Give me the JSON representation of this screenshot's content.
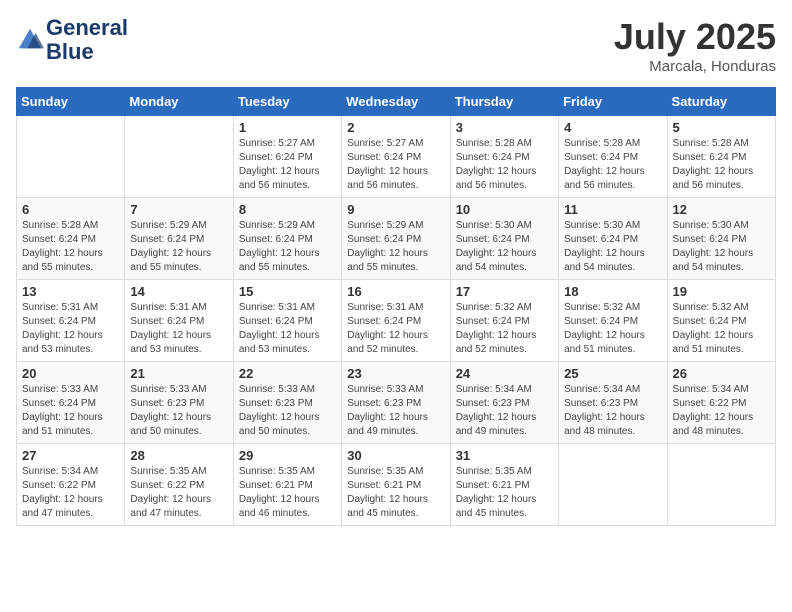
{
  "header": {
    "logo_line1": "General",
    "logo_line2": "Blue",
    "month": "July 2025",
    "location": "Marcala, Honduras"
  },
  "weekdays": [
    "Sunday",
    "Monday",
    "Tuesday",
    "Wednesday",
    "Thursday",
    "Friday",
    "Saturday"
  ],
  "weeks": [
    [
      {
        "day": "",
        "info": ""
      },
      {
        "day": "",
        "info": ""
      },
      {
        "day": "1",
        "info": "Sunrise: 5:27 AM\nSunset: 6:24 PM\nDaylight: 12 hours and 56 minutes."
      },
      {
        "day": "2",
        "info": "Sunrise: 5:27 AM\nSunset: 6:24 PM\nDaylight: 12 hours and 56 minutes."
      },
      {
        "day": "3",
        "info": "Sunrise: 5:28 AM\nSunset: 6:24 PM\nDaylight: 12 hours and 56 minutes."
      },
      {
        "day": "4",
        "info": "Sunrise: 5:28 AM\nSunset: 6:24 PM\nDaylight: 12 hours and 56 minutes."
      },
      {
        "day": "5",
        "info": "Sunrise: 5:28 AM\nSunset: 6:24 PM\nDaylight: 12 hours and 56 minutes."
      }
    ],
    [
      {
        "day": "6",
        "info": "Sunrise: 5:28 AM\nSunset: 6:24 PM\nDaylight: 12 hours and 55 minutes."
      },
      {
        "day": "7",
        "info": "Sunrise: 5:29 AM\nSunset: 6:24 PM\nDaylight: 12 hours and 55 minutes."
      },
      {
        "day": "8",
        "info": "Sunrise: 5:29 AM\nSunset: 6:24 PM\nDaylight: 12 hours and 55 minutes."
      },
      {
        "day": "9",
        "info": "Sunrise: 5:29 AM\nSunset: 6:24 PM\nDaylight: 12 hours and 55 minutes."
      },
      {
        "day": "10",
        "info": "Sunrise: 5:30 AM\nSunset: 6:24 PM\nDaylight: 12 hours and 54 minutes."
      },
      {
        "day": "11",
        "info": "Sunrise: 5:30 AM\nSunset: 6:24 PM\nDaylight: 12 hours and 54 minutes."
      },
      {
        "day": "12",
        "info": "Sunrise: 5:30 AM\nSunset: 6:24 PM\nDaylight: 12 hours and 54 minutes."
      }
    ],
    [
      {
        "day": "13",
        "info": "Sunrise: 5:31 AM\nSunset: 6:24 PM\nDaylight: 12 hours and 53 minutes."
      },
      {
        "day": "14",
        "info": "Sunrise: 5:31 AM\nSunset: 6:24 PM\nDaylight: 12 hours and 53 minutes."
      },
      {
        "day": "15",
        "info": "Sunrise: 5:31 AM\nSunset: 6:24 PM\nDaylight: 12 hours and 53 minutes."
      },
      {
        "day": "16",
        "info": "Sunrise: 5:31 AM\nSunset: 6:24 PM\nDaylight: 12 hours and 52 minutes."
      },
      {
        "day": "17",
        "info": "Sunrise: 5:32 AM\nSunset: 6:24 PM\nDaylight: 12 hours and 52 minutes."
      },
      {
        "day": "18",
        "info": "Sunrise: 5:32 AM\nSunset: 6:24 PM\nDaylight: 12 hours and 51 minutes."
      },
      {
        "day": "19",
        "info": "Sunrise: 5:32 AM\nSunset: 6:24 PM\nDaylight: 12 hours and 51 minutes."
      }
    ],
    [
      {
        "day": "20",
        "info": "Sunrise: 5:33 AM\nSunset: 6:24 PM\nDaylight: 12 hours and 51 minutes."
      },
      {
        "day": "21",
        "info": "Sunrise: 5:33 AM\nSunset: 6:23 PM\nDaylight: 12 hours and 50 minutes."
      },
      {
        "day": "22",
        "info": "Sunrise: 5:33 AM\nSunset: 6:23 PM\nDaylight: 12 hours and 50 minutes."
      },
      {
        "day": "23",
        "info": "Sunrise: 5:33 AM\nSunset: 6:23 PM\nDaylight: 12 hours and 49 minutes."
      },
      {
        "day": "24",
        "info": "Sunrise: 5:34 AM\nSunset: 6:23 PM\nDaylight: 12 hours and 49 minutes."
      },
      {
        "day": "25",
        "info": "Sunrise: 5:34 AM\nSunset: 6:23 PM\nDaylight: 12 hours and 48 minutes."
      },
      {
        "day": "26",
        "info": "Sunrise: 5:34 AM\nSunset: 6:22 PM\nDaylight: 12 hours and 48 minutes."
      }
    ],
    [
      {
        "day": "27",
        "info": "Sunrise: 5:34 AM\nSunset: 6:22 PM\nDaylight: 12 hours and 47 minutes."
      },
      {
        "day": "28",
        "info": "Sunrise: 5:35 AM\nSunset: 6:22 PM\nDaylight: 12 hours and 47 minutes."
      },
      {
        "day": "29",
        "info": "Sunrise: 5:35 AM\nSunset: 6:21 PM\nDaylight: 12 hours and 46 minutes."
      },
      {
        "day": "30",
        "info": "Sunrise: 5:35 AM\nSunset: 6:21 PM\nDaylight: 12 hours and 45 minutes."
      },
      {
        "day": "31",
        "info": "Sunrise: 5:35 AM\nSunset: 6:21 PM\nDaylight: 12 hours and 45 minutes."
      },
      {
        "day": "",
        "info": ""
      },
      {
        "day": "",
        "info": ""
      }
    ]
  ]
}
